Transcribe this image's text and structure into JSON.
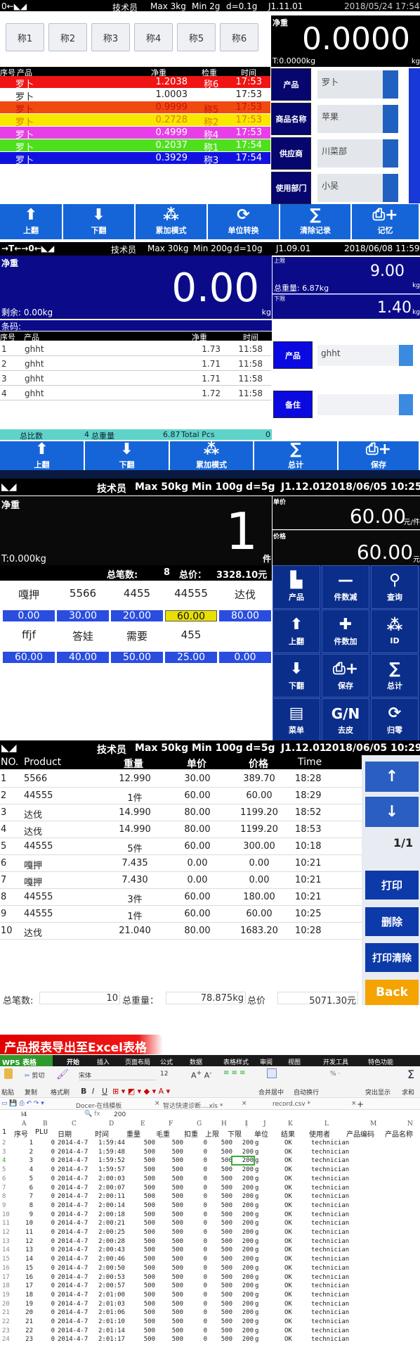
{
  "p1": {
    "status": {
      "icons": "0←◣◢",
      "user": "技术员",
      "max": "Max 3kg",
      "min": "Min 2g",
      "d": "d=0.1g",
      "version": "J1.11.01",
      "datetime": "2018/05/24  17:54"
    },
    "scales": [
      "称1",
      "称2",
      "称3",
      "称4",
      "称5",
      "称6"
    ],
    "weight": {
      "label": "净重",
      "value": "0.0000",
      "tare": "T:0.0000kg",
      "unit": "kg"
    },
    "headers": {
      "no": "序号",
      "product": "产品",
      "net": "净重",
      "check": "检重",
      "time": "时间"
    },
    "rows": [
      {
        "product": "罗卜",
        "net": "1.2038",
        "check": "称6",
        "time": "17:53",
        "bg": "#f01414",
        "fg": "#ffffff"
      },
      {
        "product": "罗卜",
        "net": "1.0003",
        "check": "",
        "time": "17:53",
        "bg": "#ffffff",
        "fg": "#222222"
      },
      {
        "product": "罗卜",
        "net": "0.9999",
        "check": "称5",
        "time": "17:53",
        "bg": "#f04a10",
        "fg": "#c81010"
      },
      {
        "product": "罗卜",
        "net": "0.2728",
        "check": "称2",
        "time": "17:53",
        "bg": "#f8e800",
        "fg": "#e07a00"
      },
      {
        "product": "罗卜",
        "net": "0.4999",
        "check": "称4",
        "time": "17:53",
        "bg": "#e83ee8",
        "fg": "#ffffff"
      },
      {
        "product": "罗卜",
        "net": "0.2037",
        "check": "称1",
        "time": "17:54",
        "bg": "#4ee01c",
        "fg": "#ffffff"
      },
      {
        "product": "罗卜",
        "net": "0.3929",
        "check": "称3",
        "time": "17:54",
        "bg": "#1212e0",
        "fg": "#ffffff"
      }
    ],
    "fields": [
      {
        "label": "产品",
        "value": "罗卜"
      },
      {
        "label": "商品名称",
        "value": "苹果"
      },
      {
        "label": "供应商",
        "value": "川菜部"
      },
      {
        "label": "使用部门",
        "value": "小吴"
      }
    ],
    "buttons": [
      {
        "label": "上翻",
        "icon": "arrow-up"
      },
      {
        "label": "下翻",
        "icon": "arrow-down"
      },
      {
        "label": "累加模式",
        "icon": "accumulate"
      },
      {
        "label": "单位转换",
        "icon": "refresh"
      },
      {
        "label": "清除记录",
        "icon": "sigma"
      },
      {
        "label": "记忆",
        "icon": "printer-plus"
      }
    ]
  },
  "p2": {
    "status": {
      "icons": "→T←→0←◣◢",
      "user": "技术员",
      "max": "Max 30kg",
      "min": "Min 200g",
      "d": "d=10g",
      "version": "J1.09.01",
      "datetime": "2018/06/08  11:59"
    },
    "weight": {
      "label": "净重",
      "value": "0.00",
      "remain": "剩余:   0.00kg",
      "unit": "kg"
    },
    "barcode": "条码:",
    "upper": {
      "label": "上限",
      "value": "9.00",
      "unit": "kg",
      "total": "总重量:   6.87kg"
    },
    "lower": {
      "label": "下限",
      "value": "1.40",
      "unit": "kg"
    },
    "headers": {
      "no": "序号",
      "product": "产品",
      "net": "净重",
      "time": "时间"
    },
    "rows": [
      {
        "no": "1",
        "product": "ghht",
        "net": "1.73",
        "time": "11:58"
      },
      {
        "no": "2",
        "product": "ghht",
        "net": "1.71",
        "time": "11:58"
      },
      {
        "no": "3",
        "product": "ghht",
        "net": "1.71",
        "time": "11:58"
      },
      {
        "no": "4",
        "product": "ghht",
        "net": "1.72",
        "time": "11:58"
      }
    ],
    "fields": [
      {
        "label": "产品",
        "value": "ghht"
      },
      {
        "label": "备住",
        "value": ""
      }
    ],
    "summary": {
      "count_label": "总比数",
      "count": "4",
      "weight_label": "总重量",
      "weight": "6.87",
      "pcs_label": "Total Pcs",
      "pcs": "0"
    },
    "buttons": [
      {
        "label": "上翻",
        "icon": "arrow-up"
      },
      {
        "label": "下翻",
        "icon": "arrow-down"
      },
      {
        "label": "累加模式",
        "icon": "accumulate"
      },
      {
        "label": "总计",
        "icon": "sigma"
      },
      {
        "label": "保存",
        "icon": "printer-plus"
      }
    ]
  },
  "p3": {
    "status": {
      "icons": "◣◢",
      "user": "技术员",
      "max": "Max 50kg",
      "min": "Min 100g",
      "d": "d=5g",
      "version": "J1.12.01",
      "datetime": "2018/06/05  10:25"
    },
    "weight": {
      "label": "净重",
      "value": "1",
      "unit": "件",
      "tare": "T:0.000kg"
    },
    "unit_price": {
      "label": "单价",
      "value": "60.00",
      "unit": "元/件"
    },
    "price": {
      "label": "价格",
      "value": "60.00",
      "unit": "元"
    },
    "totals": {
      "count_label": "总笔数:",
      "count": "8",
      "price_label": "总价：",
      "price": "3328.10元"
    },
    "products": [
      {
        "name": "嘎押",
        "price": "0.00"
      },
      {
        "name": "5566",
        "price": "30.00"
      },
      {
        "name": "4455",
        "price": "20.00"
      },
      {
        "name": "44555",
        "price": "60.00",
        "selected": true
      },
      {
        "name": "达伐",
        "price": "80.00"
      },
      {
        "name": "ffjf",
        "price": "60.00"
      },
      {
        "name": "答娃",
        "price": "40.00"
      },
      {
        "name": "需要",
        "price": "50.00"
      },
      {
        "name": "455",
        "price": "25.00"
      },
      {
        "name": "",
        "price": "0.00"
      }
    ],
    "selected_color": "#e8e000",
    "buttons": [
      {
        "label": "产品",
        "icon": "product"
      },
      {
        "label": "件数减",
        "icon": "minus"
      },
      {
        "label": "查询",
        "icon": "search"
      },
      {
        "label": "上翻",
        "icon": "arrow-up"
      },
      {
        "label": "件数加",
        "icon": "plus"
      },
      {
        "label": "ID",
        "icon": "accumulate"
      },
      {
        "label": "下翻",
        "icon": "arrow-down"
      },
      {
        "label": "保存",
        "icon": "printer-plus"
      },
      {
        "label": "总计",
        "icon": "sigma"
      },
      {
        "label": "菜单",
        "icon": "notebook"
      },
      {
        "label": "去皮",
        "icon": "G/N"
      },
      {
        "label": "归零",
        "icon": "refresh"
      }
    ]
  },
  "p4": {
    "status": {
      "icons": "◣◢",
      "user": "技术员",
      "max": "Max 50kg",
      "min": "Min 100g",
      "d": "d=5g",
      "version": "J1.12.01",
      "datetime": "2018/06/05  10:29"
    },
    "headers": {
      "no": "NO.",
      "product": "Product",
      "weight": "重量",
      "unit_price": "单价",
      "price": "价格",
      "time": "Time"
    },
    "rows": [
      {
        "no": "1",
        "product": "5566",
        "weight": "12.990",
        "unit_price": "30.00",
        "price": "389.70",
        "time": "18:28"
      },
      {
        "no": "2",
        "product": "44555",
        "weight": "1件",
        "unit_price": "60.00",
        "price": "60.00",
        "time": "18:29"
      },
      {
        "no": "3",
        "product": "达伐",
        "weight": "14.990",
        "unit_price": "80.00",
        "price": "1199.20",
        "time": "18:52"
      },
      {
        "no": "4",
        "product": "达伐",
        "weight": "14.990",
        "unit_price": "80.00",
        "price": "1199.20",
        "time": "18:53"
      },
      {
        "no": "5",
        "product": "44555",
        "weight": "5件",
        "unit_price": "60.00",
        "price": "300.00",
        "time": "10:18"
      },
      {
        "no": "6",
        "product": "嘎押",
        "weight": "7.435",
        "unit_price": "0.00",
        "price": "0.00",
        "time": "10:21"
      },
      {
        "no": "7",
        "product": "嘎押",
        "weight": "7.430",
        "unit_price": "0.00",
        "price": "0.00",
        "time": "10:21"
      },
      {
        "no": "8",
        "product": "44555",
        "weight": "3件",
        "unit_price": "60.00",
        "price": "180.00",
        "time": "10:21"
      },
      {
        "no": "9",
        "product": "44555",
        "weight": "1件",
        "unit_price": "60.00",
        "price": "60.00",
        "time": "10:25"
      },
      {
        "no": "10",
        "product": "达伐",
        "weight": "21.040",
        "unit_price": "80.00",
        "price": "1683.20",
        "time": "10:28"
      }
    ],
    "page": "1/1",
    "buttons": {
      "up": "↑",
      "down": "↓",
      "print": "打印",
      "delete": "删除",
      "print_clear": "打印清除",
      "back": "Back"
    },
    "back_color": "#f5a300",
    "totals": {
      "count_label": "总笔数:",
      "count": "10",
      "weight_label": "总重量：",
      "weight": "78.875kg",
      "price_label": "总价",
      "price": "5071.30元"
    }
  },
  "excel": {
    "banner": "产品报表导出至Excel表格",
    "app": "WPS 表格",
    "tabs": [
      "开始",
      "插入",
      "页面布局",
      "公式",
      "数据",
      "表格样式",
      "审阅",
      "视图",
      "开发工具",
      "特色功能"
    ],
    "toolbar": {
      "paste": "粘贴",
      "cut": "剪切",
      "copy": "复制",
      "format_painter": "格式刷",
      "font": "宋体",
      "size": "12",
      "bold": "B",
      "italic": "I",
      "underline": "U",
      "merge": "合并居中",
      "wrap": "自动换行",
      "highlight": "突出显示",
      "sum": "求和"
    },
    "docs": [
      "Docer-在线模板",
      "智达快速诊断....xls *",
      "record.csv *"
    ],
    "cell_ref": "I4",
    "formula": "200",
    "columns": [
      "A",
      "B",
      "C",
      "D",
      "E",
      "F",
      "G",
      "H",
      "I",
      "J",
      "K",
      "L",
      "M",
      "N"
    ],
    "header_row": [
      "1",
      "序号",
      "PLU",
      "日期",
      "时间",
      "重量",
      "毛重",
      "扣重",
      "上限",
      "下限",
      "单位",
      "结果",
      "使用者",
      "产品编码",
      "产品名称"
    ],
    "rows": [
      [
        "2",
        "1",
        "0",
        "2014-4-7",
        "1:59:44",
        "500",
        "500",
        "0",
        "500",
        "200",
        "g",
        "OK",
        "technician"
      ],
      [
        "3",
        "2",
        "0",
        "2014-4-7",
        "1:59:48",
        "500",
        "500",
        "0",
        "500",
        "200",
        "g",
        "OK",
        "technician"
      ],
      [
        "4",
        "3",
        "0",
        "2014-4-7",
        "1:59:52",
        "500",
        "500",
        "0",
        "500",
        "200",
        "g",
        "OK",
        "technician"
      ],
      [
        "5",
        "4",
        "0",
        "2014-4-7",
        "1:59:57",
        "500",
        "500",
        "0",
        "500",
        "200",
        "g",
        "OK",
        "technician"
      ],
      [
        "6",
        "5",
        "0",
        "2014-4-7",
        "2:00:03",
        "500",
        "500",
        "0",
        "500",
        "200",
        "g",
        "OK",
        "technician"
      ],
      [
        "7",
        "6",
        "0",
        "2014-4-7",
        "2:00:07",
        "500",
        "500",
        "0",
        "500",
        "200",
        "g",
        "OK",
        "technician"
      ],
      [
        "8",
        "7",
        "0",
        "2014-4-7",
        "2:00:11",
        "500",
        "500",
        "0",
        "500",
        "200",
        "g",
        "OK",
        "technician"
      ],
      [
        "9",
        "8",
        "0",
        "2014-4-7",
        "2:00:14",
        "500",
        "500",
        "0",
        "500",
        "200",
        "g",
        "OK",
        "technician"
      ],
      [
        "10",
        "9",
        "0",
        "2014-4-7",
        "2:00:18",
        "500",
        "500",
        "0",
        "500",
        "200",
        "g",
        "OK",
        "technician"
      ],
      [
        "11",
        "10",
        "0",
        "2014-4-7",
        "2:00:21",
        "500",
        "500",
        "0",
        "500",
        "200",
        "g",
        "OK",
        "technician"
      ],
      [
        "12",
        "11",
        "0",
        "2014-4-7",
        "2:00:25",
        "500",
        "500",
        "0",
        "500",
        "200",
        "g",
        "OK",
        "technician"
      ],
      [
        "13",
        "12",
        "0",
        "2014-4-7",
        "2:00:28",
        "500",
        "500",
        "0",
        "500",
        "200",
        "g",
        "OK",
        "technician"
      ],
      [
        "14",
        "13",
        "0",
        "2014-4-7",
        "2:00:43",
        "500",
        "500",
        "0",
        "500",
        "200",
        "g",
        "OK",
        "technician"
      ],
      [
        "15",
        "14",
        "0",
        "2014-4-7",
        "2:00:46",
        "500",
        "500",
        "0",
        "500",
        "200",
        "g",
        "OK",
        "technician"
      ],
      [
        "16",
        "15",
        "0",
        "2014-4-7",
        "2:00:50",
        "500",
        "500",
        "0",
        "500",
        "200",
        "g",
        "OK",
        "technician"
      ],
      [
        "17",
        "16",
        "0",
        "2014-4-7",
        "2:00:53",
        "500",
        "500",
        "0",
        "500",
        "200",
        "g",
        "OK",
        "technician"
      ],
      [
        "18",
        "17",
        "0",
        "2014-4-7",
        "2:00:57",
        "500",
        "500",
        "0",
        "500",
        "200",
        "g",
        "OK",
        "technician"
      ],
      [
        "19",
        "18",
        "0",
        "2014-4-7",
        "2:01:00",
        "500",
        "500",
        "0",
        "500",
        "200",
        "g",
        "OK",
        "technician"
      ],
      [
        "20",
        "19",
        "0",
        "2014-4-7",
        "2:01:03",
        "500",
        "500",
        "0",
        "500",
        "200",
        "g",
        "OK",
        "technician"
      ],
      [
        "21",
        "20",
        "0",
        "2014-4-7",
        "2:01:06",
        "500",
        "500",
        "0",
        "500",
        "200",
        "g",
        "OK",
        "technician"
      ],
      [
        "22",
        "21",
        "0",
        "2014-4-7",
        "2:01:10",
        "500",
        "500",
        "0",
        "500",
        "200",
        "g",
        "OK",
        "technician"
      ],
      [
        "23",
        "22",
        "0",
        "2014-4-7",
        "2:01:14",
        "500",
        "500",
        "0",
        "500",
        "200",
        "g",
        "OK",
        "technician"
      ],
      [
        "24",
        "23",
        "0",
        "2014-4-7",
        "2:01:17",
        "500",
        "500",
        "0",
        "500",
        "200",
        "g",
        "OK",
        "technician"
      ]
    ],
    "selected_color": "#3aa83a"
  }
}
